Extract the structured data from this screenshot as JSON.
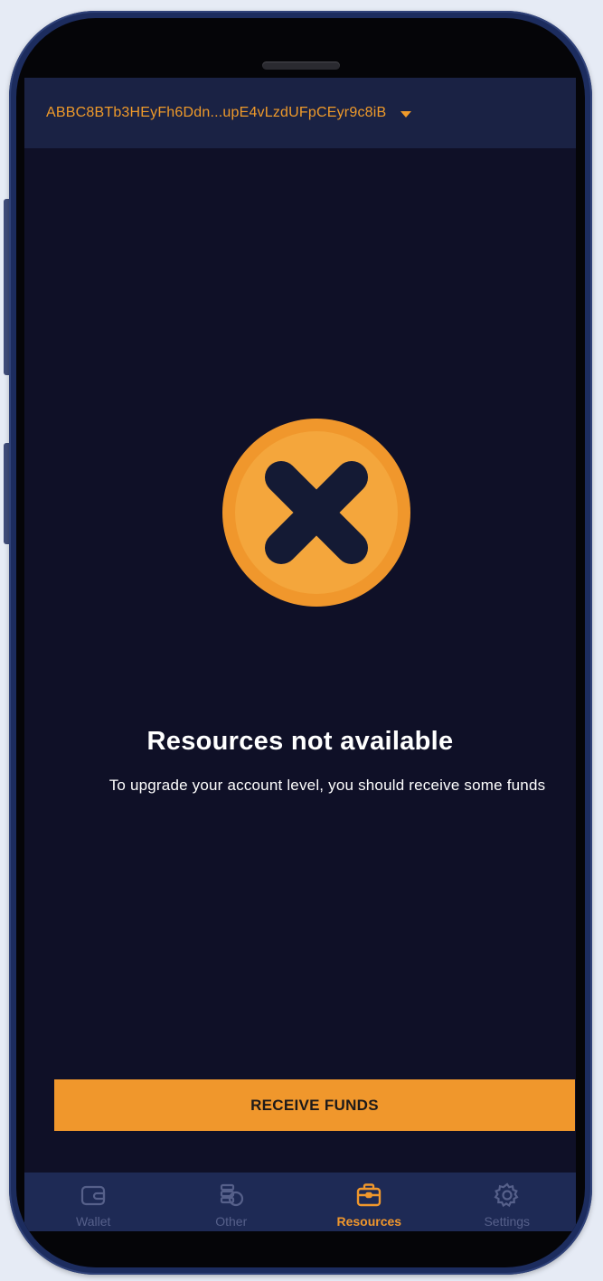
{
  "header": {
    "account_address": "ABBC8BTb3HEyFh6Ddn...upE4vLzdUFpCEyr9c8iB",
    "dropdown_icon": "caret-down-icon"
  },
  "empty_state": {
    "icon": "error-circle-x-icon",
    "title": "Resources not available",
    "message": "To upgrade your account level, you should receive some funds"
  },
  "actions": {
    "receive_funds_label": "RECEIVE FUNDS"
  },
  "tabbar": {
    "items": [
      {
        "label": "Wallet",
        "icon": "wallet-icon",
        "active": false
      },
      {
        "label": "Other",
        "icon": "coins-icon",
        "active": false
      },
      {
        "label": "Resources",
        "icon": "briefcase-icon",
        "active": true
      },
      {
        "label": "Settings",
        "icon": "gear-icon",
        "active": false
      }
    ]
  },
  "colors": {
    "accent": "#f0972c",
    "background": "#0f1027",
    "header": "#1a2244",
    "tabbar": "#1e2a55",
    "inactive": "#56608a"
  }
}
